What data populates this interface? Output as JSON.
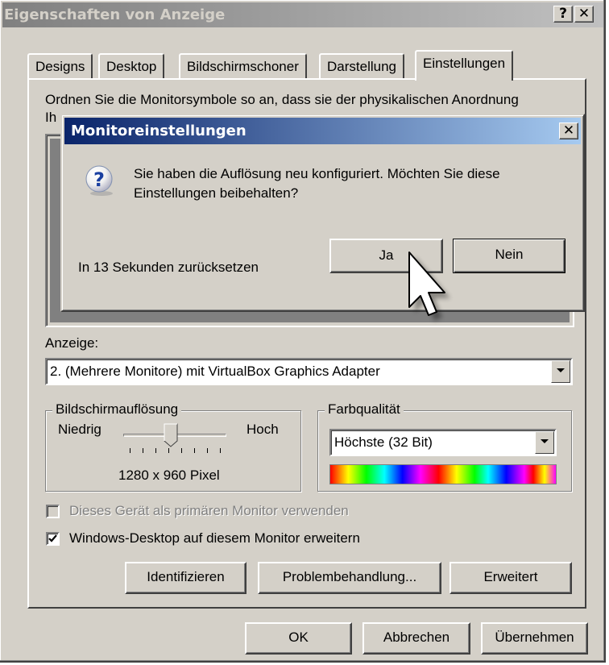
{
  "window": {
    "title": "Eigenschaften von Anzeige",
    "help_btn": "?",
    "close_btn": "✕"
  },
  "tabs": [
    "Designs",
    "Desktop",
    "Bildschirmschoner",
    "Darstellung",
    "Einstellungen"
  ],
  "active_tab": "Einstellungen",
  "settings": {
    "instruction_line1": "Ordnen Sie die Monitorsymbole so an, dass sie der physikalischen Anordnung",
    "instruction_line2_partial": "Ih",
    "display_label": "Anzeige:",
    "display_value": "2. (Mehrere Monitore) mit VirtualBox Graphics Adapter",
    "resolution_group": "Bildschirmauflösung",
    "low_label": "Niedrig",
    "high_label": "Hoch",
    "resolution_value": "1280 x 960 Pixel",
    "color_group": "Farbqualität",
    "color_value": "Höchste (32 Bit)",
    "primary_checkbox": "Dieses Gerät als primären Monitor verwenden",
    "primary_checked": false,
    "extend_checkbox": "Windows-Desktop auf diesem Monitor erweitern",
    "extend_checked": true,
    "identify_btn": "Identifizieren",
    "troubleshoot_btn": "Problembehandlung...",
    "advanced_btn": "Erweitert"
  },
  "footer": {
    "ok": "OK",
    "cancel": "Abbrechen",
    "apply": "Übernehmen"
  },
  "dialog": {
    "title": "Monitoreinstellungen",
    "close_btn": "✕",
    "message_line1": "Sie haben die Auflösung neu konfiguriert. Möchten Sie diese",
    "message_line2": "Einstellungen beibehalten?",
    "countdown": "In 13 Sekunden zurücksetzen",
    "yes": "Ja",
    "no": "Nein",
    "icon": "question-icon"
  }
}
